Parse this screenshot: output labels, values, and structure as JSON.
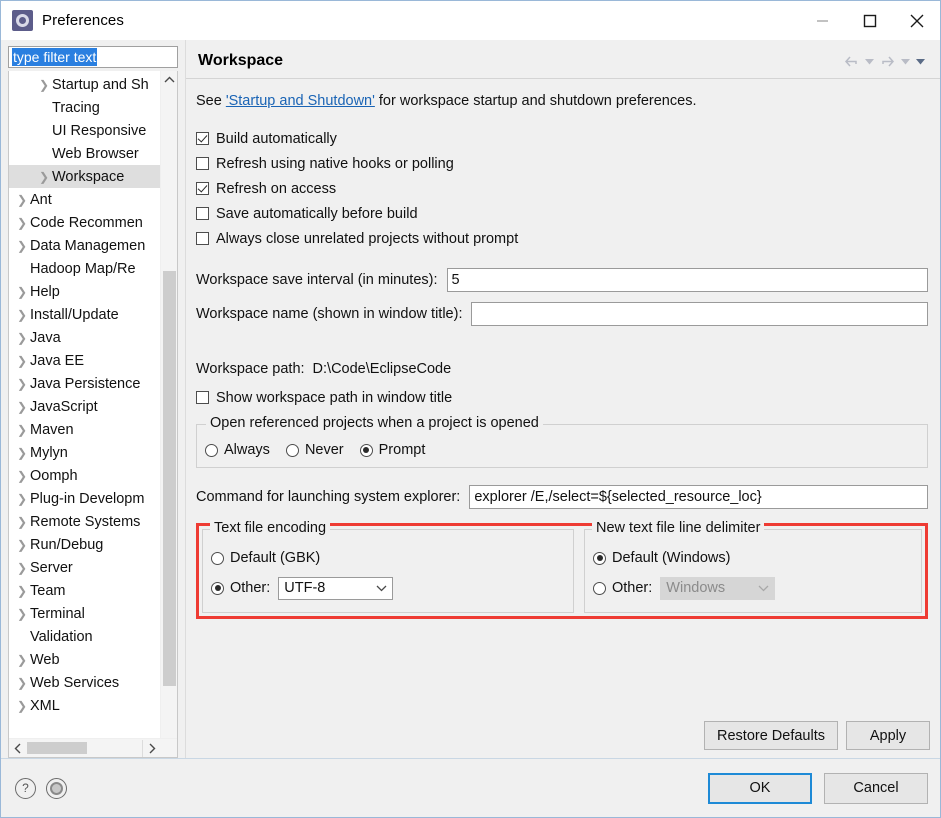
{
  "window": {
    "title": "Preferences",
    "icon": "eclipse-icon",
    "controls": {
      "minimize": "minimize-icon",
      "maximize": "maximize-icon",
      "close": "close-icon"
    }
  },
  "sidebar": {
    "filter": {
      "value": "type filter text",
      "placeholder": "type filter text"
    },
    "items": [
      {
        "label": "Startup and Sh",
        "level": 2,
        "expandable": true,
        "selected": false
      },
      {
        "label": "Tracing",
        "level": 2,
        "expandable": false,
        "selected": false
      },
      {
        "label": "UI Responsive",
        "level": 2,
        "expandable": false,
        "selected": false
      },
      {
        "label": "Web Browser",
        "level": 2,
        "expandable": false,
        "selected": false
      },
      {
        "label": "Workspace",
        "level": 2,
        "expandable": true,
        "selected": true
      },
      {
        "label": "Ant",
        "level": 1,
        "expandable": true,
        "selected": false
      },
      {
        "label": "Code Recommen",
        "level": 1,
        "expandable": true,
        "selected": false
      },
      {
        "label": "Data Managemen",
        "level": 1,
        "expandable": true,
        "selected": false
      },
      {
        "label": "Hadoop Map/Re",
        "level": 1,
        "expandable": false,
        "selected": false
      },
      {
        "label": "Help",
        "level": 1,
        "expandable": true,
        "selected": false
      },
      {
        "label": "Install/Update",
        "level": 1,
        "expandable": true,
        "selected": false
      },
      {
        "label": "Java",
        "level": 1,
        "expandable": true,
        "selected": false
      },
      {
        "label": "Java EE",
        "level": 1,
        "expandable": true,
        "selected": false
      },
      {
        "label": "Java Persistence",
        "level": 1,
        "expandable": true,
        "selected": false
      },
      {
        "label": "JavaScript",
        "level": 1,
        "expandable": true,
        "selected": false
      },
      {
        "label": "Maven",
        "level": 1,
        "expandable": true,
        "selected": false
      },
      {
        "label": "Mylyn",
        "level": 1,
        "expandable": true,
        "selected": false
      },
      {
        "label": "Oomph",
        "level": 1,
        "expandable": true,
        "selected": false
      },
      {
        "label": "Plug-in Developm",
        "level": 1,
        "expandable": true,
        "selected": false
      },
      {
        "label": "Remote Systems",
        "level": 1,
        "expandable": true,
        "selected": false
      },
      {
        "label": "Run/Debug",
        "level": 1,
        "expandable": true,
        "selected": false
      },
      {
        "label": "Server",
        "level": 1,
        "expandable": true,
        "selected": false
      },
      {
        "label": "Team",
        "level": 1,
        "expandable": true,
        "selected": false
      },
      {
        "label": "Terminal",
        "level": 1,
        "expandable": true,
        "selected": false
      },
      {
        "label": "Validation",
        "level": 1,
        "expandable": false,
        "selected": false
      },
      {
        "label": "Web",
        "level": 1,
        "expandable": true,
        "selected": false
      },
      {
        "label": "Web Services",
        "level": 1,
        "expandable": true,
        "selected": false
      },
      {
        "label": "XML",
        "level": 1,
        "expandable": true,
        "selected": false
      }
    ]
  },
  "page": {
    "title": "Workspace",
    "intro_before": "See ",
    "intro_link": "'Startup and Shutdown'",
    "intro_after": " for workspace startup and shutdown preferences.",
    "checkboxes": [
      {
        "label": "Build automatically",
        "checked": true
      },
      {
        "label": "Refresh using native hooks or polling",
        "checked": false
      },
      {
        "label": "Refresh on access",
        "checked": true
      },
      {
        "label": "Save automatically before build",
        "checked": false
      },
      {
        "label": "Always close unrelated projects without prompt",
        "checked": false
      }
    ],
    "save_interval": {
      "label": "Workspace save interval (in minutes):",
      "value": "5"
    },
    "workspace_name": {
      "label": "Workspace name (shown in window title):",
      "value": ""
    },
    "workspace_path": {
      "label": "Workspace path:",
      "value": "D:\\Code\\EclipseCode"
    },
    "show_path": {
      "label": "Show workspace path in window title",
      "checked": false
    },
    "open_referenced": {
      "title": "Open referenced projects when a project is opened",
      "options": [
        {
          "label": "Always",
          "selected": false
        },
        {
          "label": "Never",
          "selected": false
        },
        {
          "label": "Prompt",
          "selected": true
        }
      ]
    },
    "explorer_command": {
      "label": "Command for launching system explorer:",
      "value": "explorer /E,/select=${selected_resource_loc}"
    },
    "text_file_encoding": {
      "title": "Text file encoding",
      "default": {
        "label": "Default (GBK)",
        "selected": false
      },
      "other": {
        "label": "Other:",
        "selected": true,
        "value": "UTF-8"
      }
    },
    "line_delimiter": {
      "title": "New text file line delimiter",
      "default": {
        "label": "Default (Windows)",
        "selected": true
      },
      "other": {
        "label": "Other:",
        "selected": false,
        "value": "Windows",
        "disabled": true
      }
    },
    "restore_defaults_label": "Restore Defaults",
    "apply_label": "Apply"
  },
  "footer": {
    "help_icon": "help-icon",
    "settings_icon": "gear-icon",
    "ok_label": "OK",
    "cancel_label": "Cancel"
  },
  "colors": {
    "accent": "#1e8ad6",
    "highlight_box": "#ee3b33",
    "link": "#1a64b5",
    "selection": "#2a7fe0",
    "dialog_bg": "#f0f0f0"
  }
}
